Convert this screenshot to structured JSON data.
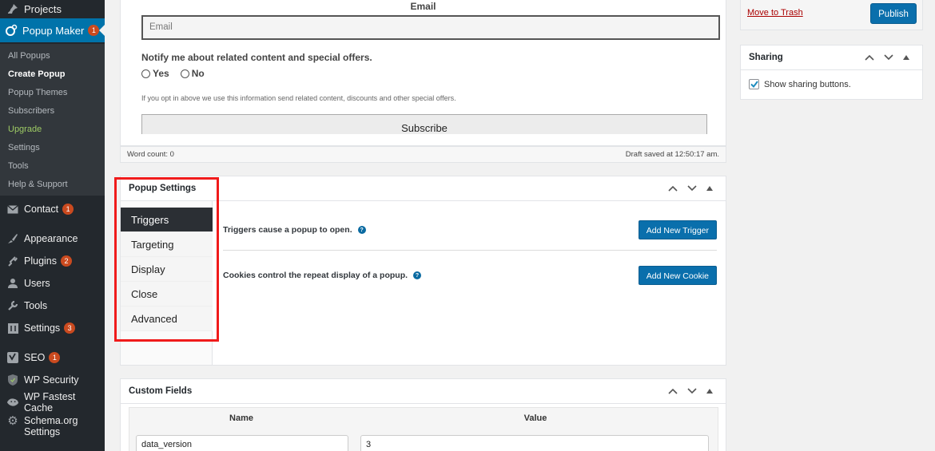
{
  "sidebar": {
    "top_item": {
      "label": "Projects",
      "icon": "pin-icon"
    },
    "current": {
      "label": "Popup Maker",
      "badge": "1",
      "icon": "popup-maker-icon"
    },
    "submenu": [
      {
        "label": "All Popups"
      },
      {
        "label": "Create Popup",
        "current": true
      },
      {
        "label": "Popup Themes"
      },
      {
        "label": "Subscribers"
      },
      {
        "label": "Upgrade",
        "highlight_color": "#9ecb65"
      },
      {
        "label": "Settings"
      },
      {
        "label": "Tools"
      },
      {
        "label": "Help & Support"
      }
    ],
    "items": [
      {
        "label": "Contact",
        "badge": "1",
        "icon": "envelope-icon"
      },
      {
        "label": "Appearance",
        "icon": "paintbrush-icon"
      },
      {
        "label": "Plugins",
        "badge": "2",
        "icon": "plugin-icon"
      },
      {
        "label": "Users",
        "icon": "user-icon"
      },
      {
        "label": "Tools",
        "icon": "wrench-icon"
      },
      {
        "label": "Settings",
        "badge": "3",
        "icon": "settings-icon"
      },
      {
        "label": "SEO",
        "badge": "1",
        "icon": "yoast-icon"
      },
      {
        "label": "WP Security",
        "icon": "shield-icon"
      },
      {
        "label": "WP Fastest Cache",
        "icon": "cheetah-icon"
      },
      {
        "label": "Schema.org Settings",
        "icon": "gear-icon"
      }
    ]
  },
  "editor": {
    "email_label": "Email",
    "email_placeholder": "Email",
    "notify_text": "Notify me about related content and special offers.",
    "radio_yes": "Yes",
    "radio_no": "No",
    "optin_text": "If you opt in above we use this information send related content, discounts and other special offers.",
    "subscribe_label": "Subscribe",
    "word_count": "Word count: 0",
    "draft_saved": "Draft saved at 12:50:17 am."
  },
  "popup_settings": {
    "title": "Popup Settings",
    "tabs": [
      "Triggers",
      "Targeting",
      "Display",
      "Close",
      "Advanced"
    ],
    "active_tab": "Triggers",
    "triggers_text": "Triggers cause a popup to open.",
    "add_trigger_label": "Add New Trigger",
    "cookies_text": "Cookies control the repeat display of a popup.",
    "add_cookie_label": "Add New Cookie",
    "help_glyph": "?"
  },
  "custom_fields": {
    "title": "Custom Fields",
    "col_name": "Name",
    "col_value": "Value",
    "rows": [
      {
        "name": "data_version",
        "value": "3"
      }
    ]
  },
  "publish": {
    "trash_label": "Move to Trash",
    "publish_label": "Publish"
  },
  "sharing": {
    "title": "Sharing",
    "checkbox_label": "Show sharing buttons.",
    "checked": true
  },
  "colors": {
    "sidebar_bg": "#23282d",
    "sidebar_active": "#0073aa",
    "button_primary": "#0a6fac",
    "badge": "#ca4a1f",
    "highlight_box": "#f01b1b"
  }
}
